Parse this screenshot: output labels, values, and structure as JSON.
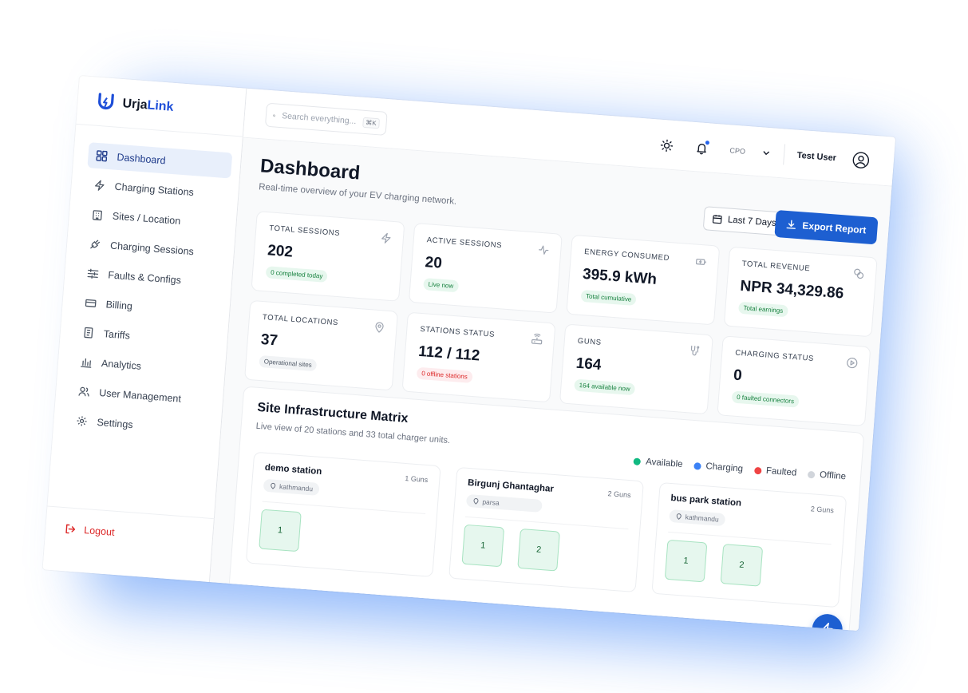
{
  "brand": {
    "name_part1": "Urja",
    "name_part2": "Link",
    "accent_color": "#1d4ed8"
  },
  "sidebar": {
    "items": [
      {
        "label": "Dashboard",
        "icon": "dashboard-icon",
        "active": true
      },
      {
        "label": "Charging Stations",
        "icon": "bolt-icon"
      },
      {
        "label": "Sites / Location",
        "icon": "building-icon"
      },
      {
        "label": "Charging Sessions",
        "icon": "plug-icon"
      },
      {
        "label": "Faults & Configs",
        "icon": "sliders-icon"
      },
      {
        "label": "Billing",
        "icon": "credit-card-icon"
      },
      {
        "label": "Tariffs",
        "icon": "document-icon"
      },
      {
        "label": "Analytics",
        "icon": "bar-chart-icon"
      },
      {
        "label": "User Management",
        "icon": "users-icon"
      },
      {
        "label": "Settings",
        "icon": "gear-icon"
      }
    ],
    "logout": "Logout"
  },
  "header": {
    "search_placeholder": "Search everything...",
    "search_shortcut": "⌘K",
    "role": "CPO",
    "user": "Test User"
  },
  "page": {
    "title": "Dashboard",
    "subtitle": "Real-time overview of your EV charging network.",
    "range_label": "Last 7 Days",
    "export_label": "Export Report"
  },
  "stats": [
    {
      "label": "TOTAL SESSIONS",
      "value": "202",
      "badge": "0 completed today",
      "badge_style": "green",
      "icon": "bolt-icon"
    },
    {
      "label": "ACTIVE SESSIONS",
      "value": "20",
      "badge": "Live now",
      "badge_style": "green",
      "icon": "activity-icon"
    },
    {
      "label": "ENERGY CONSUMED",
      "value": "395.9 kWh",
      "badge": "Total cumulative",
      "badge_style": "green",
      "icon": "battery-icon"
    },
    {
      "label": "TOTAL REVENUE",
      "value": "NPR 34,329.86",
      "badge": "Total earnings",
      "badge_style": "green",
      "icon": "coins-icon"
    },
    {
      "label": "TOTAL LOCATIONS",
      "value": "37",
      "badge": "Operational sites",
      "badge_style": "gray",
      "icon": "map-pin-icon"
    },
    {
      "label": "STATIONS STATUS",
      "value": "112 / 112",
      "badge": "0 offline stations",
      "badge_style": "red",
      "icon": "router-icon"
    },
    {
      "label": "GUNS",
      "value": "164",
      "badge": "164 available now",
      "badge_style": "green",
      "icon": "connector-icon"
    },
    {
      "label": "CHARGING STATUS",
      "value": "0",
      "badge": "0 faulted connectors",
      "badge_style": "green",
      "icon": "play-circle-icon"
    }
  ],
  "matrix": {
    "title": "Site Infrastructure Matrix",
    "subtitle": "Live view of 20 stations and 33 total charger units.",
    "legend": [
      {
        "label": "Available",
        "color": "#10b981"
      },
      {
        "label": "Charging",
        "color": "#3b82f6"
      },
      {
        "label": "Faulted",
        "color": "#ef4444"
      },
      {
        "label": "Offline",
        "color": "#d1d5db"
      }
    ],
    "stations": [
      {
        "name": "demo station",
        "guns_label": "1 Guns",
        "location": "kathmandu",
        "guns": [
          "1"
        ]
      },
      {
        "name": "Birgunj Ghantaghar",
        "guns_label": "2 Guns",
        "location": "parsa",
        "guns": [
          "1",
          "2"
        ]
      },
      {
        "name": "bus park station",
        "guns_label": "2 Guns",
        "location": "kathmandu",
        "guns": [
          "1",
          "2"
        ]
      }
    ]
  }
}
